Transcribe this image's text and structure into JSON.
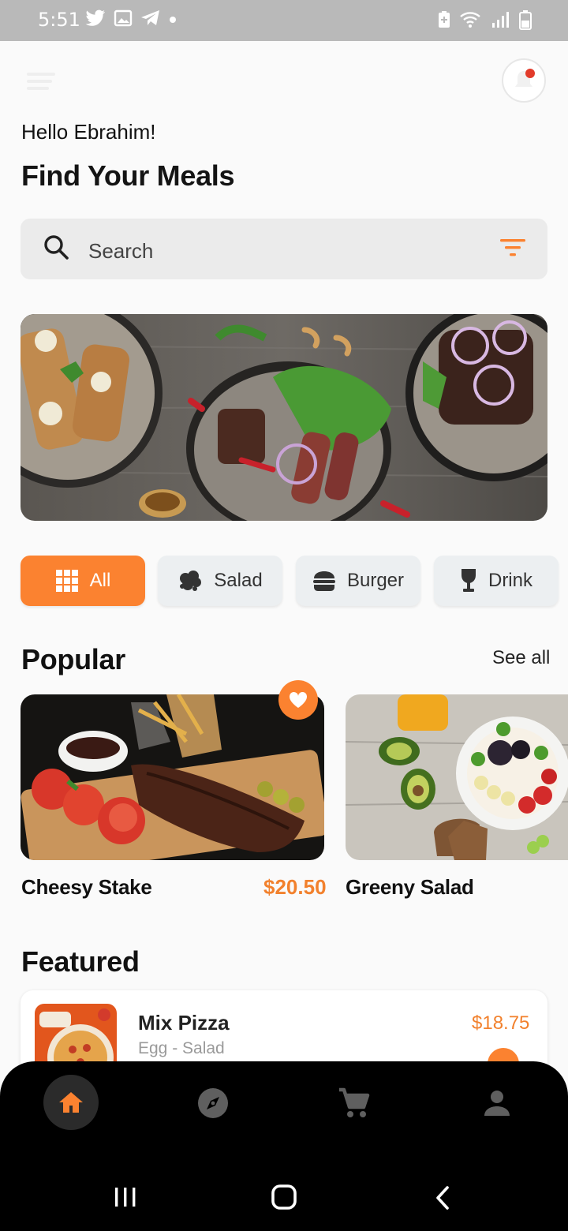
{
  "status_bar": {
    "time": "5:51",
    "left_icons": [
      "twitter-icon",
      "gallery-icon",
      "telegram-icon",
      "dot-icon"
    ],
    "right_icons": [
      "battery-saver-icon",
      "wifi-icon",
      "signal-icon",
      "battery-icon"
    ]
  },
  "header": {
    "greeting": "Hello Ebrahim!",
    "title": "Find Your Meals",
    "notification_badge": true
  },
  "search": {
    "placeholder": "Search",
    "icon": "search-icon",
    "filter_icon": "filter-icon"
  },
  "categories": [
    {
      "label": "All",
      "icon": "grid-icon",
      "active": true
    },
    {
      "label": "Salad",
      "icon": "salad-icon",
      "active": false
    },
    {
      "label": "Burger",
      "icon": "burger-icon",
      "active": false
    },
    {
      "label": "Drink",
      "icon": "drink-icon",
      "active": false
    }
  ],
  "popular": {
    "title": "Popular",
    "see_all": "See all",
    "items": [
      {
        "name": "Cheesy Stake",
        "price": "$20.50",
        "favorite": true
      },
      {
        "name": "Greeny Salad",
        "price": "",
        "favorite": false
      }
    ]
  },
  "featured": {
    "title": "Featured",
    "items": [
      {
        "name": "Mix Pizza",
        "subtitle": "Egg - Salad",
        "price": "$18.75",
        "favorite": true
      }
    ]
  },
  "bottom_nav": {
    "items": [
      "home-icon",
      "explore-icon",
      "cart-icon",
      "profile-icon"
    ],
    "active": "home-icon"
  },
  "colors": {
    "accent": "#fb8230",
    "price": "#f2812d",
    "chip_bg": "#eceff1",
    "search_bg": "#ebebeb",
    "nav_bg": "#000000"
  }
}
